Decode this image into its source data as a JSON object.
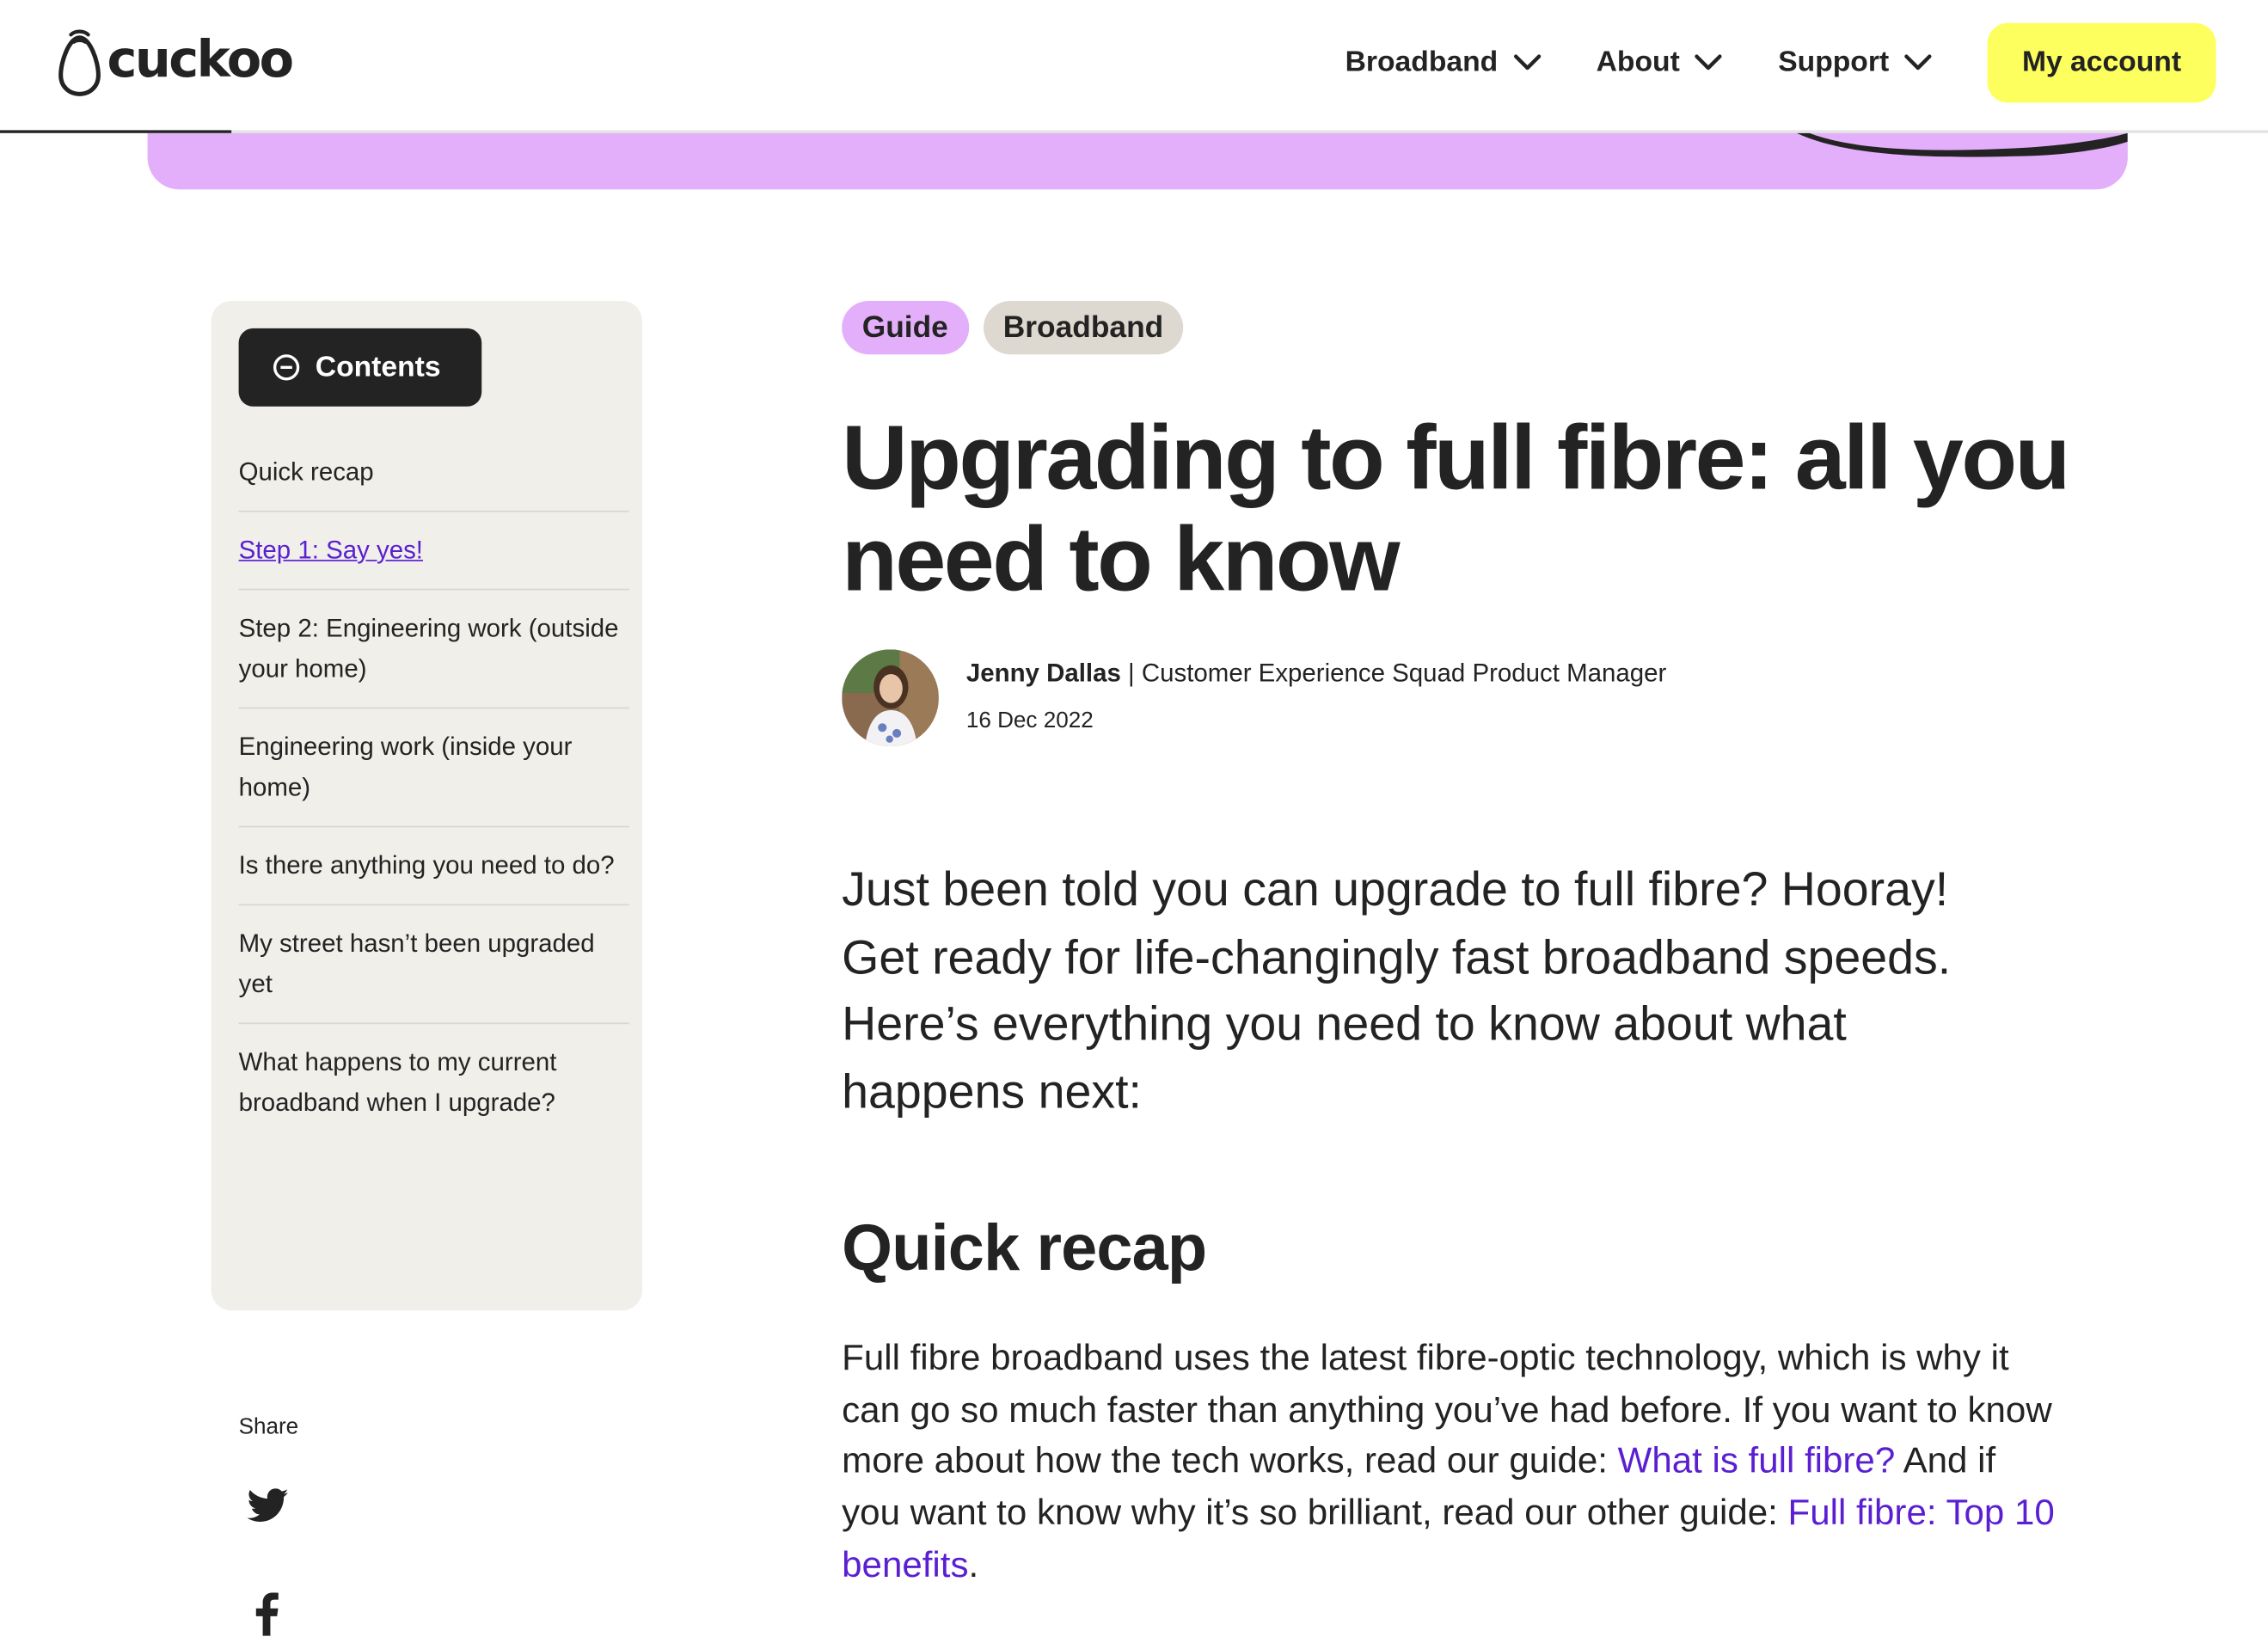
{
  "brand": {
    "name": "cuckoo",
    "accent_yellow": "#fcff5e",
    "accent_purple": "#e4affa",
    "link_color": "#5a1fd1",
    "text_color": "#232323"
  },
  "nav": {
    "items": [
      {
        "label": "Broadband",
        "icon": "chevron-down-icon"
      },
      {
        "label": "About",
        "icon": "chevron-down-icon"
      },
      {
        "label": "Support",
        "icon": "chevron-down-icon"
      }
    ],
    "account_label": "My account"
  },
  "sidebar": {
    "contents_label": "Contents",
    "contents_icon": "minus-circle-icon",
    "items": [
      {
        "label": "Quick recap",
        "active": false
      },
      {
        "label": "Step 1: Say yes!",
        "active": true
      },
      {
        "label": "Step 2: Engineering work (outside your home)",
        "active": false
      },
      {
        "label": "Engineering work (inside your home)",
        "active": false
      },
      {
        "label": "Is there anything you need to do?",
        "active": false
      },
      {
        "label": "My street hasn’t been upgraded yet",
        "active": false
      },
      {
        "label": "What happens to my current broadband when I upgrade?",
        "active": false
      }
    ],
    "share_label": "Share",
    "share_icons": [
      "twitter-icon",
      "facebook-icon"
    ]
  },
  "article": {
    "tags": [
      "Guide",
      "Broadband"
    ],
    "title": "Upgrading to full fibre: all you need to know",
    "author": {
      "name": "Jenny Dallas",
      "separator": " | ",
      "role": "Customer Experience Squad Product Manager",
      "date": "16 Dec 2022"
    },
    "intro": "Just been told you can upgrade to full fibre? Hooray! Get ready for life-changingly fast broadband speeds. Here’s everything you need to know about what happens next:",
    "section_heading": "Quick recap",
    "body": {
      "text_1": "Full fibre broadband uses the latest fibre-optic technology, which is why it can go so much faster than anything you’ve had before. If you want to know more about how the tech works, read our guide: ",
      "link_1": "What is full fibre?",
      "text_2": " And if you want to know why it’s so brilliant, read our other guide: ",
      "link_2": "Full fibre: Top 10 benefits",
      "text_3": "."
    }
  }
}
